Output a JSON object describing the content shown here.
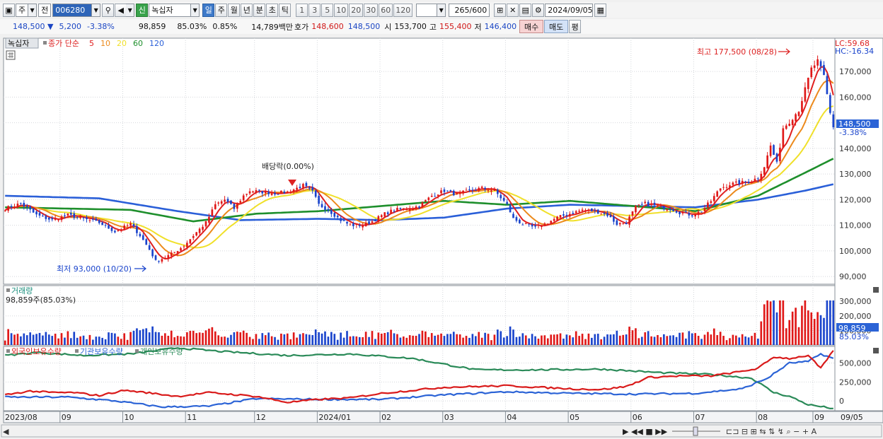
{
  "toolbar": {
    "market_label": "주",
    "period_label": "전",
    "code": "006280",
    "badge": "신",
    "name": "녹십자",
    "periods": [
      "일",
      "주",
      "월",
      "년",
      "분",
      "초",
      "틱"
    ],
    "intervals": [
      "1",
      "3",
      "5",
      "10",
      "20",
      "30",
      "60",
      "120"
    ],
    "count": "265",
    "count_total": "/600",
    "date": "2024/09/05"
  },
  "quote": {
    "price": "148,500",
    "change": "5,200",
    "pct": "-3.38%",
    "volume": "98,859",
    "vol_ratio": "85.03%",
    "turnover": "0.85%",
    "amount": "14,789백만",
    "bid_label": "호가",
    "bid": "148,600",
    "ask": "148,500",
    "open_label": "시",
    "open": "153,700",
    "high_label": "고",
    "high": "155,400",
    "low_label": "저",
    "low": "146,400",
    "buy_label": "매수",
    "sell_label": "매도",
    "avg_label": "평"
  },
  "price_panel": {
    "stock_name": "녹십자",
    "legend_title": "종가 단순",
    "ma_labels": [
      "5",
      "10",
      "20",
      "60",
      "120"
    ],
    "ma_colors": [
      "#e02020",
      "#ec8a1c",
      "#f0e02a",
      "#1e8f2c",
      "#2a5fd8"
    ],
    "lc": "LC:59.68",
    "hc": "HC:-16.34",
    "high_note": "최고 177,500 (08/28)",
    "low_note": "최저 93,000 (10/20)",
    "dividend_note": "배당락(0.00%)",
    "last_price": "148,500",
    "last_pct": "-3.38%"
  },
  "volume_panel": {
    "title": "거래량",
    "info": "98,859주(85.03%)",
    "last": "98,859",
    "last_pct": "85.03%"
  },
  "holding_panel": {
    "legend": [
      "외국인보유수량",
      "기관보유수량",
      "개인보유수량"
    ],
    "colors": [
      "#d91a1a",
      "#2b63d6",
      "#2a8a58"
    ]
  },
  "chart_data": {
    "type": "candlestick",
    "y_ticks": [
      "170,000",
      "160,000",
      "150,000",
      "140,000",
      "130,000",
      "120,000",
      "110,000",
      "100,000",
      "90,000"
    ],
    "y_tick_values": [
      170000,
      160000,
      150000,
      140000,
      130000,
      120000,
      110000,
      100000,
      90000
    ],
    "ylim": [
      87000,
      183000
    ],
    "vol_ticks": [
      "300,000",
      "200,000",
      "100,000"
    ],
    "vol_tick_values": [
      300000,
      200000,
      100000
    ],
    "vol_max": 340000,
    "hold_ticks": [
      "500,000",
      "250,000",
      "0"
    ],
    "hold_tick_values": [
      500000,
      250000,
      0
    ],
    "hold_range": [
      -130000,
      720000
    ],
    "x_labels": [
      "2023/08",
      "09",
      "10",
      "11",
      "12",
      "2024/01",
      "02",
      "03",
      "04",
      "05",
      "06",
      "07",
      "08",
      "09",
      "09/05"
    ],
    "x_label_days": [
      0,
      18,
      38,
      58,
      80,
      100,
      120,
      140,
      160,
      180,
      200,
      220,
      240,
      258,
      264
    ],
    "days": 265,
    "close_anchors": [
      [
        0,
        116500
      ],
      [
        5,
        118500
      ],
      [
        10,
        114000
      ],
      [
        15,
        112000
      ],
      [
        20,
        114000
      ],
      [
        25,
        112500
      ],
      [
        30,
        111000
      ],
      [
        35,
        107500
      ],
      [
        40,
        110500
      ],
      [
        43,
        106000
      ],
      [
        46,
        100500
      ],
      [
        48,
        96000
      ],
      [
        51,
        97500
      ],
      [
        54,
        99500
      ],
      [
        57,
        102000
      ],
      [
        60,
        106000
      ],
      [
        64,
        111000
      ],
      [
        67,
        118000
      ],
      [
        70,
        120000
      ],
      [
        73,
        116500
      ],
      [
        76,
        121500
      ],
      [
        78,
        123500
      ],
      [
        82,
        123000
      ],
      [
        86,
        122500
      ],
      [
        90,
        123000
      ],
      [
        95,
        125500
      ],
      [
        98,
        123000
      ],
      [
        100,
        118000
      ],
      [
        103,
        116000
      ],
      [
        107,
        112000
      ],
      [
        110,
        110000
      ],
      [
        114,
        110000
      ],
      [
        117,
        111500
      ],
      [
        121,
        114500
      ],
      [
        124,
        116000
      ],
      [
        128,
        116500
      ],
      [
        132,
        117500
      ],
      [
        136,
        121500
      ],
      [
        140,
        123500
      ],
      [
        144,
        122000
      ],
      [
        148,
        123500
      ],
      [
        152,
        124500
      ],
      [
        156,
        123500
      ],
      [
        160,
        118000
      ],
      [
        162,
        112500
      ],
      [
        165,
        110500
      ],
      [
        169,
        109000
      ],
      [
        172,
        110500
      ],
      [
        176,
        113000
      ],
      [
        180,
        114500
      ],
      [
        184,
        116000
      ],
      [
        188,
        115500
      ],
      [
        192,
        114000
      ],
      [
        195,
        110500
      ],
      [
        198,
        111000
      ],
      [
        201,
        117000
      ],
      [
        204,
        118500
      ],
      [
        208,
        117500
      ],
      [
        212,
        116500
      ],
      [
        215,
        115000
      ],
      [
        219,
        114000
      ],
      [
        222,
        115500
      ],
      [
        225,
        119500
      ],
      [
        228,
        124500
      ],
      [
        231,
        126000
      ],
      [
        234,
        126500
      ],
      [
        237,
        127000
      ],
      [
        240,
        128500
      ],
      [
        242,
        133000
      ],
      [
        244,
        141000
      ],
      [
        246,
        134000
      ],
      [
        248,
        148000
      ],
      [
        250,
        150500
      ],
      [
        253,
        155000
      ],
      [
        255,
        163000
      ],
      [
        257,
        171000
      ],
      [
        259,
        174000
      ],
      [
        261,
        168000
      ],
      [
        263,
        153700
      ],
      [
        264,
        148500
      ]
    ],
    "ma60_anchors": [
      [
        0,
        117000
      ],
      [
        40,
        116000
      ],
      [
        60,
        111500
      ],
      [
        80,
        114500
      ],
      [
        100,
        115500
      ],
      [
        120,
        117500
      ],
      [
        140,
        119500
      ],
      [
        160,
        118000
      ],
      [
        180,
        119500
      ],
      [
        200,
        117500
      ],
      [
        220,
        115500
      ],
      [
        240,
        121500
      ],
      [
        255,
        130500
      ],
      [
        264,
        136000
      ]
    ],
    "ma120_anchors": [
      [
        0,
        121500
      ],
      [
        30,
        120500
      ],
      [
        55,
        115500
      ],
      [
        75,
        112000
      ],
      [
        100,
        112500
      ],
      [
        120,
        112000
      ],
      [
        140,
        113000
      ],
      [
        160,
        116500
      ],
      [
        180,
        118000
      ],
      [
        200,
        117500
      ],
      [
        220,
        117000
      ],
      [
        240,
        120000
      ],
      [
        255,
        123500
      ],
      [
        264,
        126000
      ]
    ],
    "foreign_anchors": [
      [
        0,
        80000
      ],
      [
        8,
        130000
      ],
      [
        15,
        110000
      ],
      [
        22,
        110000
      ],
      [
        30,
        70000
      ],
      [
        38,
        140000
      ],
      [
        45,
        110000
      ],
      [
        55,
        60000
      ],
      [
        65,
        110000
      ],
      [
        80,
        60000
      ],
      [
        90,
        -20000
      ],
      [
        100,
        20000
      ],
      [
        110,
        40000
      ],
      [
        120,
        100000
      ],
      [
        140,
        180000
      ],
      [
        160,
        200000
      ],
      [
        170,
        180000
      ],
      [
        180,
        160000
      ],
      [
        190,
        150000
      ],
      [
        198,
        190000
      ],
      [
        205,
        310000
      ],
      [
        215,
        330000
      ],
      [
        225,
        330000
      ],
      [
        235,
        390000
      ],
      [
        240,
        430000
      ],
      [
        245,
        580000
      ],
      [
        250,
        560000
      ],
      [
        256,
        600000
      ],
      [
        260,
        430000
      ],
      [
        264,
        660000
      ]
    ],
    "inst_anchors": [
      [
        0,
        50000
      ],
      [
        20,
        50000
      ],
      [
        35,
        0
      ],
      [
        50,
        -80000
      ],
      [
        65,
        -70000
      ],
      [
        80,
        30000
      ],
      [
        100,
        20000
      ],
      [
        120,
        20000
      ],
      [
        140,
        80000
      ],
      [
        160,
        120000
      ],
      [
        180,
        100000
      ],
      [
        200,
        90000
      ],
      [
        220,
        100000
      ],
      [
        235,
        160000
      ],
      [
        243,
        300000
      ],
      [
        250,
        500000
      ],
      [
        256,
        520000
      ],
      [
        260,
        620000
      ],
      [
        264,
        560000
      ]
    ],
    "indiv_anchors": [
      [
        0,
        600000
      ],
      [
        10,
        640000
      ],
      [
        25,
        600000
      ],
      [
        40,
        620000
      ],
      [
        55,
        700000
      ],
      [
        70,
        650000
      ],
      [
        90,
        600000
      ],
      [
        110,
        620000
      ],
      [
        130,
        560000
      ],
      [
        150,
        410000
      ],
      [
        170,
        410000
      ],
      [
        190,
        420000
      ],
      [
        210,
        370000
      ],
      [
        225,
        350000
      ],
      [
        238,
        300000
      ],
      [
        245,
        110000
      ],
      [
        250,
        60000
      ],
      [
        256,
        -50000
      ],
      [
        264,
        -100000
      ]
    ]
  }
}
